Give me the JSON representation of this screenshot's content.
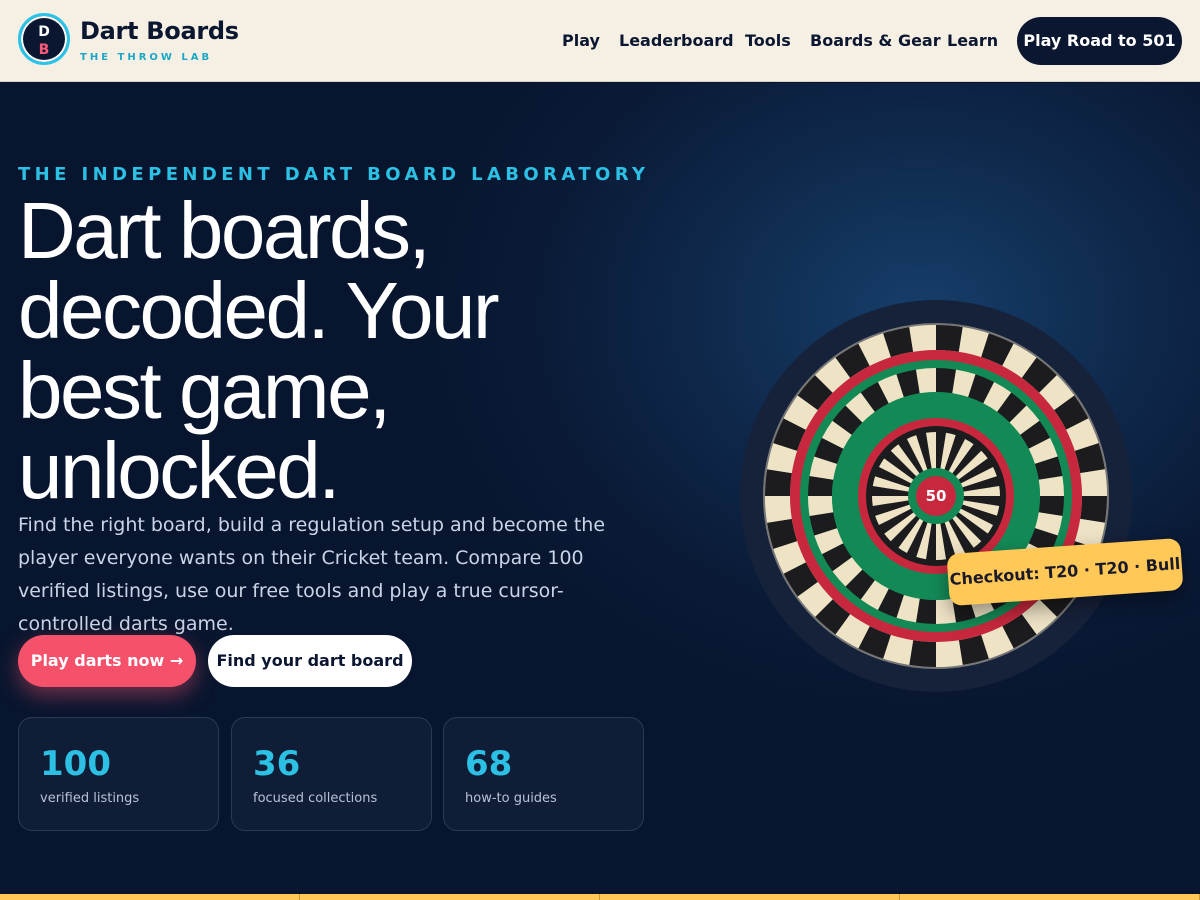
{
  "header": {
    "logo": {
      "line1": "D",
      "line2": "B"
    },
    "brand_name": "Dart Boards",
    "brand_tag": "THE THROW LAB",
    "nav": [
      "Play",
      "Leaderboard",
      "Tools",
      "Boards & Gear",
      "Learn"
    ],
    "cta": "Play Road to 501"
  },
  "hero": {
    "eyebrow": "THE INDEPENDENT DART BOARD LABORATORY",
    "headline": [
      "Dart boards,",
      "decoded. Your",
      "best game,",
      "unlocked."
    ],
    "subtext": "Find the right board, build a regulation setup and become the player everyone wants on their Cricket team. Compare 100 verified listings, use our free tools and play a true cursor-controlled darts game.",
    "primary_button": "Play darts now →",
    "secondary_button": "Find your dart board",
    "stats": [
      {
        "value": "100",
        "label": "verified listings"
      },
      {
        "value": "36",
        "label": "focused collections"
      },
      {
        "value": "68",
        "label": "how-to guides"
      }
    ],
    "board_center": "50",
    "checkout": "Checkout: T20 · T20 · Bull"
  },
  "colors": {
    "accent": "#2bc0e4",
    "primary": "#f5516b",
    "navy": "#0b1630",
    "cream": "#f6f0e4",
    "gold": "#ffc857",
    "board_red": "#c8283d",
    "board_green": "#138a55"
  }
}
